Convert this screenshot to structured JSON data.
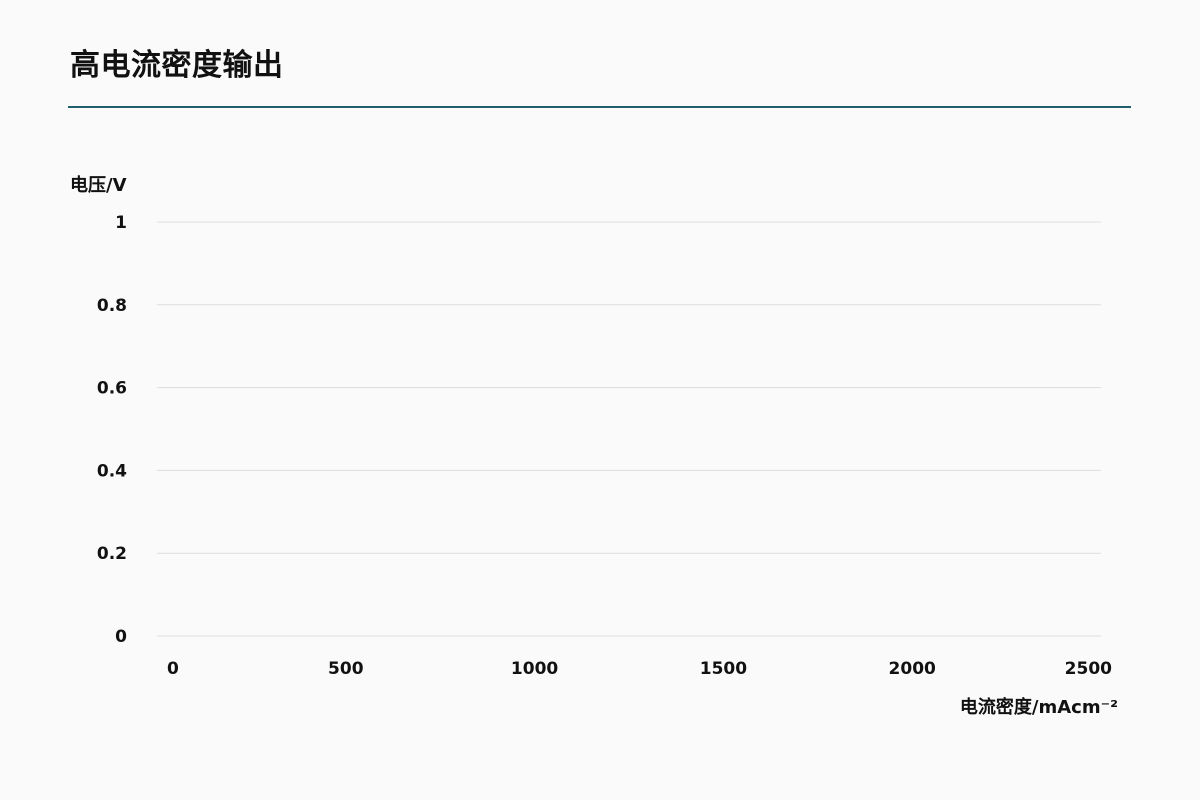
{
  "page": {
    "title": "高电流密度输出",
    "accent_color": "#1f5f6b"
  },
  "chart_data": {
    "type": "line",
    "title": "",
    "xlabel": "电流密度/mAcm⁻²",
    "ylabel": "电压/V",
    "x": [],
    "series": [],
    "xlim": [
      0,
      2500
    ],
    "ylim": [
      0,
      1
    ],
    "x_tick_labels": [
      "0",
      "500",
      "1000",
      "1500",
      "2000",
      "2500"
    ],
    "y_tick_labels": [
      "1",
      "0.8",
      "0.6",
      "0.4",
      "0.2",
      "0"
    ],
    "x_ticks": [
      0,
      500,
      1000,
      1500,
      2000,
      2500
    ],
    "y_ticks": [
      1,
      0.8,
      0.6,
      0.4,
      0.2,
      0
    ],
    "grid": true,
    "legend": "none",
    "grid_color": "#dddddd"
  }
}
